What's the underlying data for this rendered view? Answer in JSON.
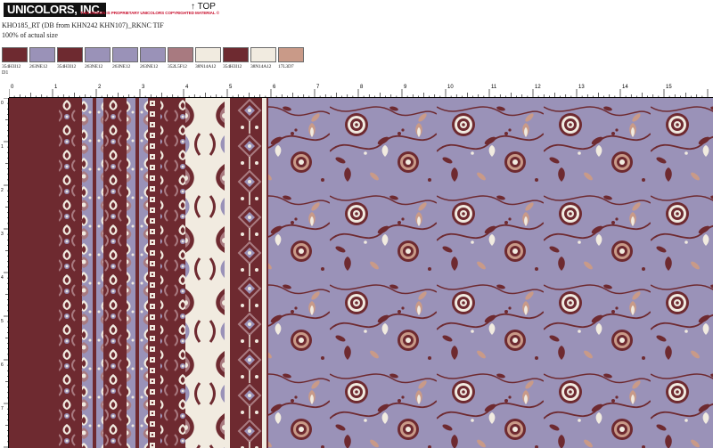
{
  "header": {
    "logo_text": "UNICOLORS, INC.",
    "proprietary_notice": "THIS DESIGN IS PROPRIETARY UNICOLORS COPYRIGHTED MATERIAL ©",
    "top_marker": "↑ TOP",
    "file_name": "KHO185_RT (DB from KHN242 KHN107)_RKNC TIF",
    "scale_label": "100% of actual size"
  },
  "swatches": [
    {
      "code": "354H3I12",
      "color": "#6e2a30"
    },
    {
      "code": "263NE12",
      "color": "#9a92b8"
    },
    {
      "code": "354H3I12",
      "color": "#6e2a30"
    },
    {
      "code": "263NE12",
      "color": "#9a92b8"
    },
    {
      "code": "263NE12",
      "color": "#9a92b8"
    },
    {
      "code": "263NE12",
      "color": "#9a92b8"
    },
    {
      "code": "352L5F12",
      "color": "#a87a80"
    },
    {
      "code": "38N14A12",
      "color": "#f1ebe0"
    },
    {
      "code": "354H3I12",
      "color": "#6e2a30"
    },
    {
      "code": "38N14A12",
      "color": "#f1ebe0"
    },
    {
      "code": "17L3D7",
      "color": "#c99a88"
    }
  ],
  "design_label": "D1",
  "ruler": {
    "top_numbers": [
      "0",
      "1",
      "2",
      "3",
      "4",
      "5",
      "6",
      "7",
      "8",
      "9",
      "10",
      "11",
      "12",
      "13",
      "14",
      "15"
    ],
    "left_numbers": [
      "0",
      "1",
      "2",
      "3",
      "4",
      "5",
      "6",
      "7"
    ]
  },
  "colors": {
    "maroon": "#6e2a30",
    "lavender": "#9a92b8",
    "mauve": "#a87a80",
    "cream": "#f1ebe0",
    "tan": "#c99a88"
  }
}
